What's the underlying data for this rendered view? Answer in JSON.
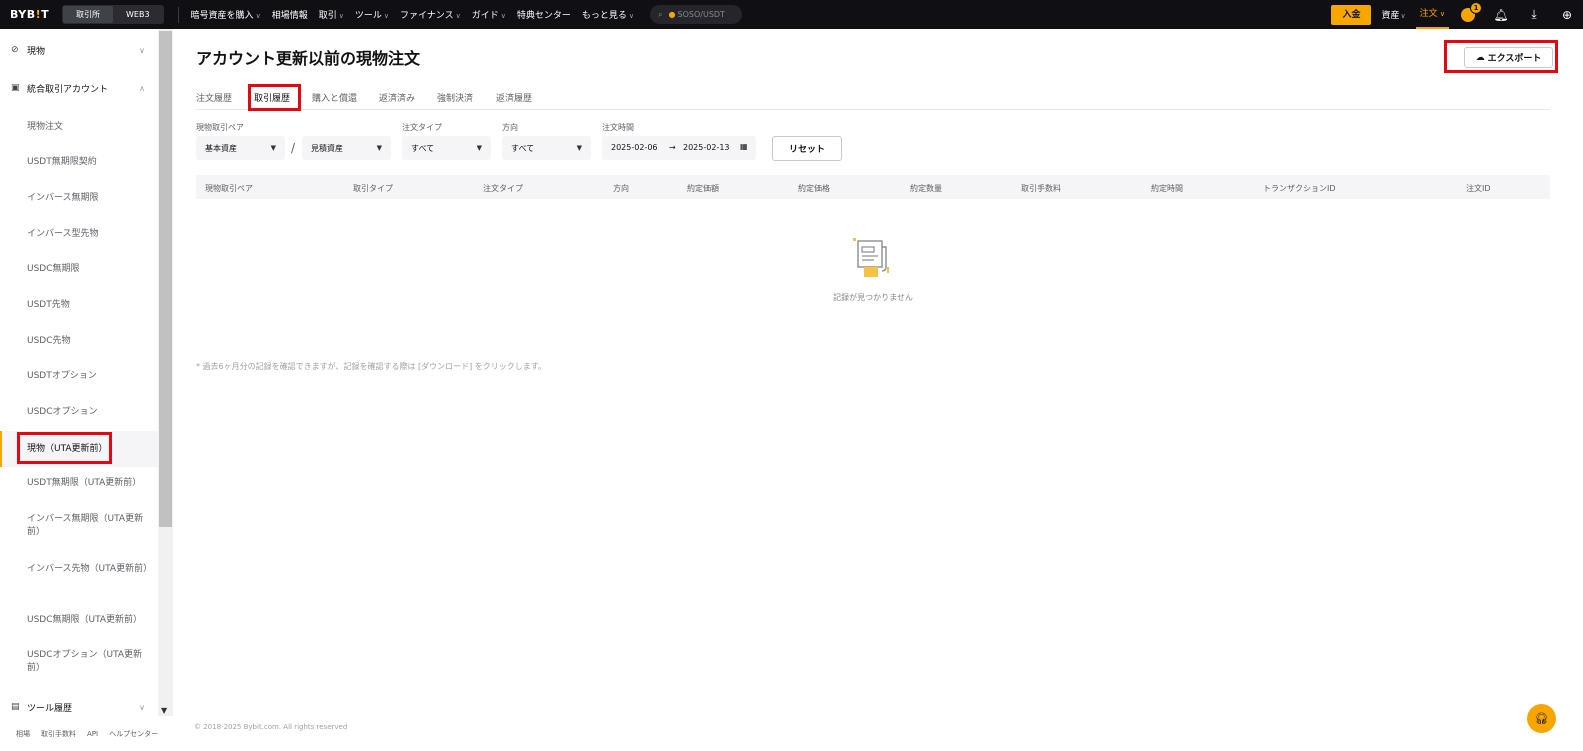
{
  "header": {
    "logo_main": "BYB",
    "logo_dot": "!",
    "logo_end": "T",
    "switch": [
      "取引所",
      "WEB3"
    ],
    "nav": [
      {
        "label": "暗号資産を購入",
        "chevron": true
      },
      {
        "label": "相場情報",
        "chevron": false
      },
      {
        "label": "取引",
        "chevron": true
      },
      {
        "label": "ツール",
        "chevron": true
      },
      {
        "label": "ファイナンス",
        "chevron": true
      },
      {
        "label": "ガイド",
        "chevron": true
      },
      {
        "label": "特典センター",
        "chevron": false
      },
      {
        "label": "もっと見る",
        "chevron": true
      }
    ],
    "search_text": "SOSO/USDT",
    "deposit": "入金",
    "assets": "資産",
    "orders": "注文",
    "notification_count": "1"
  },
  "sidebar": {
    "groups": [
      {
        "label": "現物",
        "icon": "link-icon"
      },
      {
        "label": "統合取引アカウント",
        "icon": "wallet-icon"
      },
      {
        "label": "ツール履歴",
        "icon": "document-icon"
      }
    ],
    "items": [
      "現物注文",
      "USDT無期限契約",
      "インバース無期限",
      "インバース型先物",
      "USDC無期限",
      "USDT先物",
      "USDC先物",
      "USDTオプション",
      "USDCオプション",
      "現物（UTA更新前）",
      "USDT無期限（UTA更新前）",
      "インバース無期限（UTA更新前）",
      "インバース先物（UTA更新前）",
      "USDC無期限（UTA更新前）",
      "USDCオプション（UTA更新前）"
    ],
    "active_item": "現物（UTA更新前）",
    "footer": [
      "相場",
      "取引手数料",
      "API",
      "ヘルプセンター"
    ]
  },
  "main": {
    "title": "アカウント更新以前の現物注文",
    "export_label": "エクスポート",
    "tabs": [
      "注文履歴",
      "取引履歴",
      "購入と償還",
      "返済済み",
      "強制決済",
      "返済履歴"
    ],
    "active_tab": "取引履歴",
    "filters": {
      "pair_label": "現物取引ペア",
      "base_placeholder": "基本資産",
      "quote_placeholder": "見積資産",
      "order_type_label": "注文タイプ",
      "order_type_value": "すべて",
      "side_label": "方向",
      "side_value": "すべて",
      "time_label": "注文時間",
      "date_from": "2025-02-06",
      "date_arrow": "→",
      "date_to": "2025-02-13",
      "reset": "リセット"
    },
    "columns": [
      "現物取引ペア",
      "取引タイプ",
      "注文タイプ",
      "方向",
      "約定価額",
      "約定価格",
      "約定数量",
      "取引手数料",
      "約定時間",
      "トランザクションID",
      "注文ID"
    ],
    "empty_text": "記録が見つかりません",
    "note": "* 過去6ヶ月分の記録を確認できますが、記録を確認する際は [ダウンロード] をクリックします。",
    "copyright": "© 2018-2025 Bybit.com. All rights reserved"
  },
  "colors": {
    "accent": "#f7a600",
    "header_bg": "#101014",
    "highlight": "#e30613"
  }
}
